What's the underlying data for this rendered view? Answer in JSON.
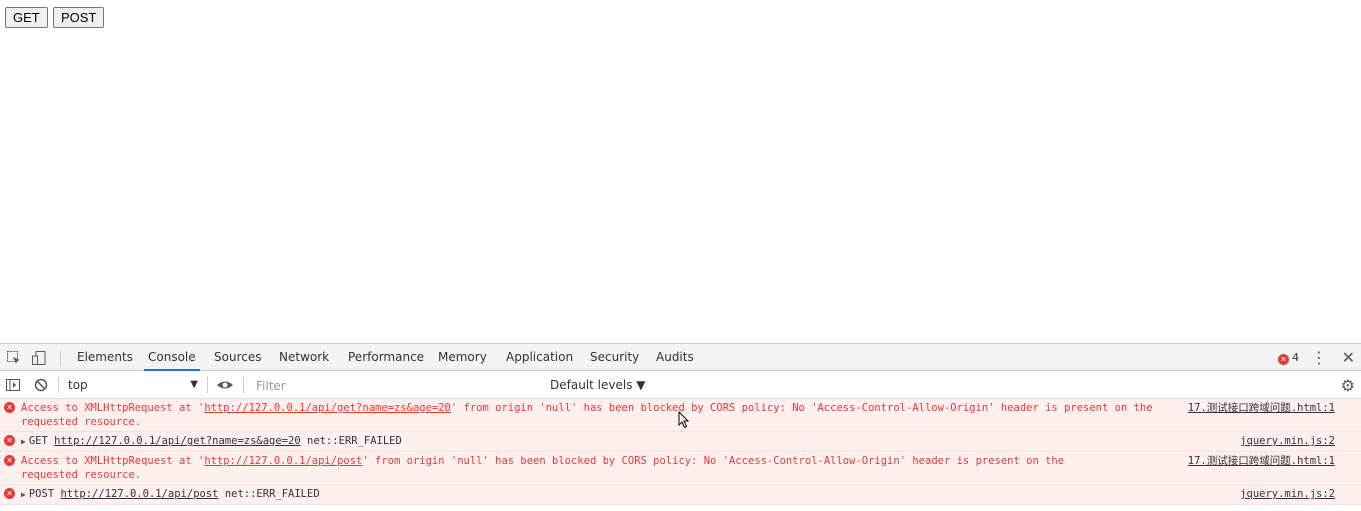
{
  "page": {
    "buttons": {
      "get": "GET",
      "post": "POST"
    }
  },
  "devtools": {
    "tabs": [
      "Elements",
      "Console",
      "Sources",
      "Network",
      "Performance",
      "Memory",
      "Application",
      "Security",
      "Audits"
    ],
    "active_tab": "Console",
    "error_count": "4",
    "toolbar": {
      "context": "top",
      "filter_placeholder": "Filter",
      "levels": "Default levels ▼"
    },
    "messages": [
      {
        "prefix": "Access to XMLHttpRequest at '",
        "url": "http://127.0.0.1/api/get?name=zs&age=20",
        "suffix": "' from origin 'null' has been blocked by CORS policy: No 'Access-Control-Allow-Origin' header is present on the requested resource.",
        "source": "17.测试接口跨域问题.html:1"
      },
      {
        "method": "GET",
        "url": "http://127.0.0.1/api/get?name=zs&age=20",
        "suffix": " net::ERR_FAILED",
        "source": "jquery.min.js:2"
      },
      {
        "prefix": "Access to XMLHttpRequest at '",
        "url": "http://127.0.0.1/api/post",
        "suffix": "' from origin 'null' has been blocked by CORS policy: No 'Access-Control-Allow-Origin' header is present on the requested resource.",
        "source": "17.测试接口跨域问题.html:1"
      },
      {
        "method": "POST",
        "url": "http://127.0.0.1/api/post",
        "suffix": " net::ERR_FAILED",
        "source": "jquery.min.js:2"
      }
    ],
    "colors": {
      "error": "#e53935",
      "error_bg": "#fff0f0",
      "accent": "#1a73e8"
    }
  }
}
